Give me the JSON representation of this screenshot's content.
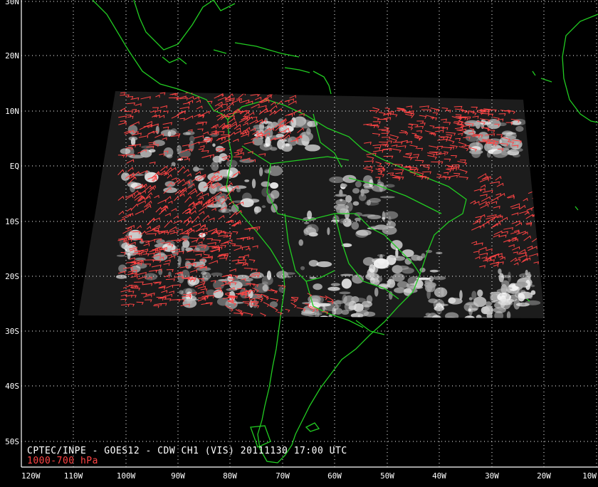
{
  "map": {
    "lat_ticks": [
      "30N",
      "20N",
      "10N",
      "EQ",
      "10S",
      "20S",
      "30S",
      "40S",
      "50S"
    ],
    "lon_ticks": [
      "120W",
      "110W",
      "100W",
      "90W",
      "80W",
      "70W",
      "60W",
      "50W",
      "40W",
      "30W",
      "20W",
      "10W"
    ],
    "colors": {
      "background": "#000000",
      "coastline": "#22cc22",
      "wind_vectors": "#ff4444",
      "grid": "#ffffff",
      "clouds": "#e8e8e8"
    }
  },
  "caption": {
    "line1": "CPTEC/INPE - GOES12 - CDW CH1 (VIS) 20111130 17:00 UTC",
    "line2": "1000-700 hPa"
  }
}
